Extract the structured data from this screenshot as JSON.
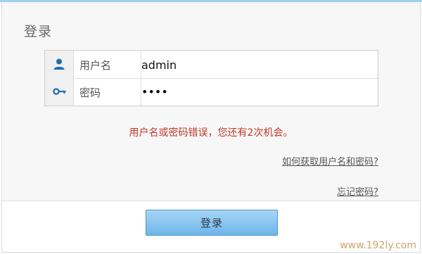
{
  "header": {
    "title": "登录"
  },
  "form": {
    "username": {
      "label": "用户名",
      "value": "admin",
      "icon": "user-icon"
    },
    "password": {
      "label": "密码",
      "value": "••••",
      "icon": "key-icon"
    }
  },
  "error_message": "用户名或密码错误，您还有2次机会。",
  "links": {
    "get_credentials": "如何获取用户名和密码?",
    "forgot_password": "忘记密码?"
  },
  "login_button": "登录",
  "watermark": "www.192ly.com",
  "colors": {
    "top_accent": "#9fd2ef",
    "error_text": "#c0392b",
    "button_fill": "#6db6ea",
    "icon": "#1a6fb0"
  }
}
